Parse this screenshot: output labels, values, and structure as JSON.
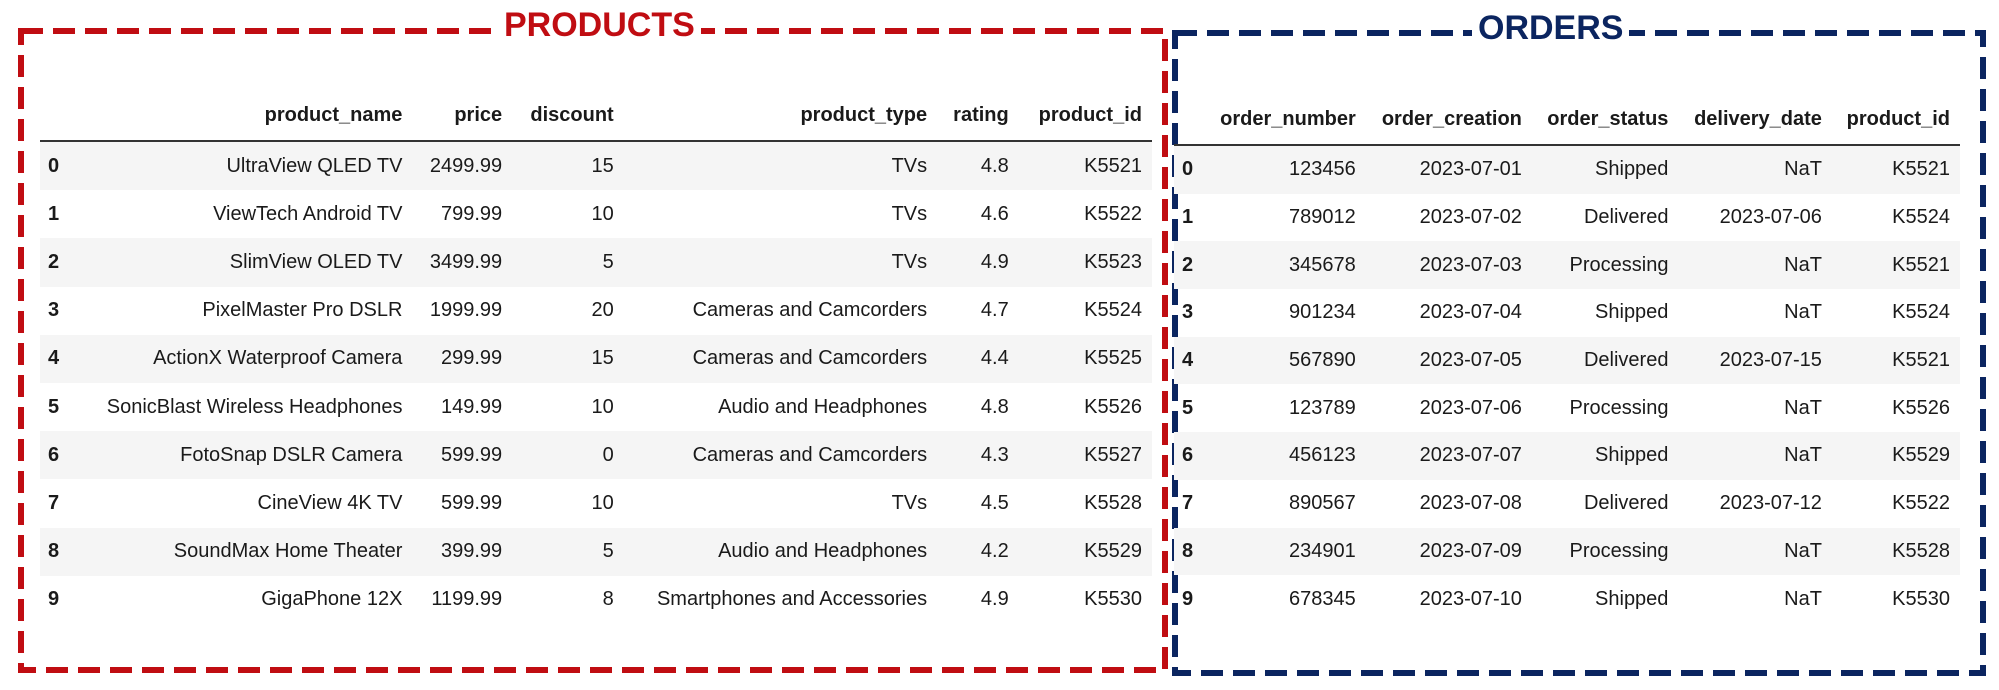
{
  "products": {
    "title": "PRODUCTS",
    "frame_color": "#c00d12",
    "columns": [
      "",
      "product_name",
      "price",
      "discount",
      "product_type",
      "rating",
      "product_id"
    ],
    "rows": [
      {
        "index": "0",
        "product_name": "UltraView QLED TV",
        "price": "2499.99",
        "discount": "15",
        "product_type": "TVs",
        "rating": "4.8",
        "product_id": "K5521"
      },
      {
        "index": "1",
        "product_name": "ViewTech Android TV",
        "price": "799.99",
        "discount": "10",
        "product_type": "TVs",
        "rating": "4.6",
        "product_id": "K5522"
      },
      {
        "index": "2",
        "product_name": "SlimView OLED TV",
        "price": "3499.99",
        "discount": "5",
        "product_type": "TVs",
        "rating": "4.9",
        "product_id": "K5523"
      },
      {
        "index": "3",
        "product_name": "PixelMaster Pro DSLR",
        "price": "1999.99",
        "discount": "20",
        "product_type": "Cameras and Camcorders",
        "rating": "4.7",
        "product_id": "K5524"
      },
      {
        "index": "4",
        "product_name": "ActionX Waterproof Camera",
        "price": "299.99",
        "discount": "15",
        "product_type": "Cameras and Camcorders",
        "rating": "4.4",
        "product_id": "K5525"
      },
      {
        "index": "5",
        "product_name": "SonicBlast Wireless Headphones",
        "price": "149.99",
        "discount": "10",
        "product_type": "Audio and Headphones",
        "rating": "4.8",
        "product_id": "K5526"
      },
      {
        "index": "6",
        "product_name": "FotoSnap DSLR Camera",
        "price": "599.99",
        "discount": "0",
        "product_type": "Cameras and Camcorders",
        "rating": "4.3",
        "product_id": "K5527"
      },
      {
        "index": "7",
        "product_name": "CineView 4K TV",
        "price": "599.99",
        "discount": "10",
        "product_type": "TVs",
        "rating": "4.5",
        "product_id": "K5528"
      },
      {
        "index": "8",
        "product_name": "SoundMax Home Theater",
        "price": "399.99",
        "discount": "5",
        "product_type": "Audio and Headphones",
        "rating": "4.2",
        "product_id": "K5529"
      },
      {
        "index": "9",
        "product_name": "GigaPhone 12X",
        "price": "1199.99",
        "discount": "8",
        "product_type": "Smartphones and Accessories",
        "rating": "4.9",
        "product_id": "K5530"
      }
    ]
  },
  "orders": {
    "title": "ORDERS",
    "frame_color": "#0b2560",
    "columns": [
      "",
      "order_number",
      "order_creation",
      "order_status",
      "delivery_date",
      "product_id"
    ],
    "rows": [
      {
        "index": "0",
        "order_number": "123456",
        "order_creation": "2023-07-01",
        "order_status": "Shipped",
        "delivery_date": "NaT",
        "product_id": "K5521"
      },
      {
        "index": "1",
        "order_number": "789012",
        "order_creation": "2023-07-02",
        "order_status": "Delivered",
        "delivery_date": "2023-07-06",
        "product_id": "K5524"
      },
      {
        "index": "2",
        "order_number": "345678",
        "order_creation": "2023-07-03",
        "order_status": "Processing",
        "delivery_date": "NaT",
        "product_id": "K5521"
      },
      {
        "index": "3",
        "order_number": "901234",
        "order_creation": "2023-07-04",
        "order_status": "Shipped",
        "delivery_date": "NaT",
        "product_id": "K5524"
      },
      {
        "index": "4",
        "order_number": "567890",
        "order_creation": "2023-07-05",
        "order_status": "Delivered",
        "delivery_date": "2023-07-15",
        "product_id": "K5521"
      },
      {
        "index": "5",
        "order_number": "123789",
        "order_creation": "2023-07-06",
        "order_status": "Processing",
        "delivery_date": "NaT",
        "product_id": "K5526"
      },
      {
        "index": "6",
        "order_number": "456123",
        "order_creation": "2023-07-07",
        "order_status": "Shipped",
        "delivery_date": "NaT",
        "product_id": "K5529"
      },
      {
        "index": "7",
        "order_number": "890567",
        "order_creation": "2023-07-08",
        "order_status": "Delivered",
        "delivery_date": "2023-07-12",
        "product_id": "K5522"
      },
      {
        "index": "8",
        "order_number": "234901",
        "order_creation": "2023-07-09",
        "order_status": "Processing",
        "delivery_date": "NaT",
        "product_id": "K5528"
      },
      {
        "index": "9",
        "order_number": "678345",
        "order_creation": "2023-07-10",
        "order_status": "Shipped",
        "delivery_date": "NaT",
        "product_id": "K5530"
      }
    ]
  }
}
